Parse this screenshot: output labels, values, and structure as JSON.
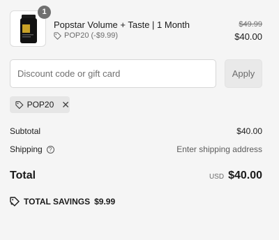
{
  "product": {
    "name": "Popstar Volume + Taste | 1 Month",
    "quantity": "1",
    "discount_line": "POP20 (-$9.99)",
    "original_price": "$49.99",
    "price": "$40.00",
    "image_icon": "supplement-bottle-icon"
  },
  "discount_form": {
    "placeholder": "Discount code or gift card",
    "value": "",
    "apply_label": "Apply"
  },
  "applied_code": {
    "code": "POP20",
    "icon": "tag-icon",
    "remove_icon": "close-icon"
  },
  "summary": {
    "subtotal_label": "Subtotal",
    "subtotal_value": "$40.00",
    "shipping_label": "Shipping",
    "shipping_value": "Enter shipping address",
    "total_label": "Total",
    "currency": "USD",
    "total_value": "$40.00",
    "savings_label": "TOTAL SAVINGS",
    "savings_value": "$9.99"
  },
  "colors": {
    "background": "#f5f5f5",
    "badge": "#707070",
    "muted_text": "#6b6b6b"
  }
}
